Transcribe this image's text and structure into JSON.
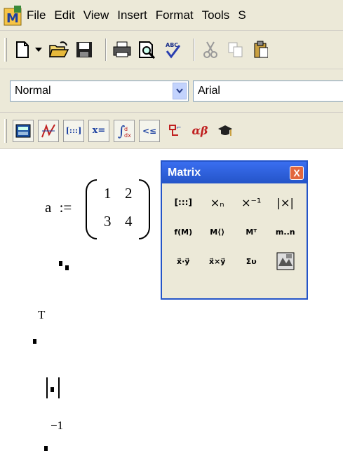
{
  "menu": {
    "items": [
      "File",
      "Edit",
      "View",
      "Insert",
      "Format",
      "Tools",
      "S"
    ]
  },
  "standard_toolbar": {
    "buttons": [
      {
        "icon": "new-document-icon"
      },
      {
        "icon": "dropdown-arrow-icon"
      },
      {
        "icon": "open-folder-icon"
      },
      {
        "icon": "save-disk-icon"
      },
      {
        "icon": "print-icon"
      },
      {
        "icon": "print-preview-icon"
      },
      {
        "icon": "spell-check-icon",
        "label": "ABC"
      },
      {
        "icon": "cut-icon"
      },
      {
        "icon": "copy-icon"
      },
      {
        "icon": "paste-icon"
      }
    ]
  },
  "format_toolbar": {
    "style_value": "Normal",
    "font_value": "Arial"
  },
  "math_toolbar": {
    "buttons": [
      {
        "name": "calculator-toolbar-button",
        "label": ""
      },
      {
        "name": "graph-toolbar-button",
        "label": ""
      },
      {
        "name": "matrix-toolbar-button",
        "label": "[:::]"
      },
      {
        "name": "evaluation-toolbar-button",
        "label": "x="
      },
      {
        "name": "calculus-toolbar-button",
        "label": "∫"
      },
      {
        "name": "boolean-toolbar-button",
        "label": "<≤"
      },
      {
        "name": "programming-toolbar-button",
        "label": ""
      },
      {
        "name": "greek-toolbar-button",
        "label": "αβ"
      },
      {
        "name": "symbolic-toolbar-button",
        "label": ""
      }
    ]
  },
  "worksheet": {
    "assignment_var": "a",
    "assignment_op": ":=",
    "matrix": [
      [
        "1",
        "2"
      ],
      [
        "3",
        "4"
      ]
    ],
    "transpose_sup": "T",
    "inverse_sup": "−1"
  },
  "matrix_palette": {
    "title": "Matrix",
    "close_label": "X",
    "buttons": [
      {
        "label": "[:::]",
        "name": "matrix-insert-button"
      },
      {
        "label": "×ₙ",
        "name": "matrix-subscript-button"
      },
      {
        "label": "×⁻¹",
        "name": "matrix-inverse-button"
      },
      {
        "label": "|×|",
        "name": "determinant-button"
      },
      {
        "label": "f(M)",
        "name": "vectorize-button"
      },
      {
        "label": "M⟨⟩",
        "name": "matrix-column-button"
      },
      {
        "label": "Mᵀ",
        "name": "matrix-transpose-button"
      },
      {
        "label": "m..n",
        "name": "range-variable-button"
      },
      {
        "label": "x⃗·y⃗",
        "name": "dot-product-button"
      },
      {
        "label": "x⃗×y⃗",
        "name": "cross-product-button"
      },
      {
        "label": "Συ",
        "name": "vector-sum-button"
      },
      {
        "label": "",
        "name": "picture-button"
      }
    ]
  }
}
